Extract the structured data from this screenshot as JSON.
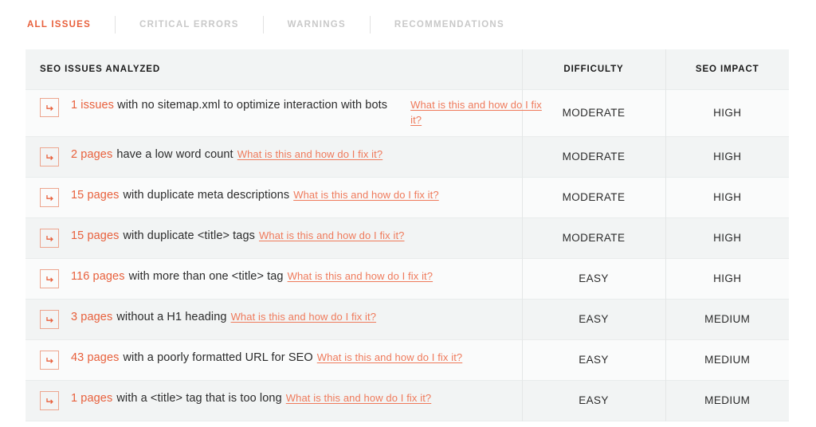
{
  "tabs": [
    {
      "label": "ALL ISSUES",
      "active": true
    },
    {
      "label": "CRITICAL ERRORS",
      "active": false
    },
    {
      "label": "WARNINGS",
      "active": false
    },
    {
      "label": "RECOMMENDATIONS",
      "active": false
    }
  ],
  "table": {
    "columns": {
      "issues": "SEO ISSUES ANALYZED",
      "difficulty": "DIFFICULTY",
      "impact": "SEO IMPACT"
    },
    "link_label": "What is this and how do I fix it?",
    "icon": "arrow-turn-right-icon",
    "rows": [
      {
        "count": "1 issues",
        "description": "with no sitemap.xml to optimize interaction with bots",
        "link": "What is this and how do I fix it?",
        "difficulty": "MODERATE",
        "impact": "HIGH"
      },
      {
        "count": "2 pages",
        "description": "have a low word count",
        "link": "What is this and how do I fix it?",
        "difficulty": "MODERATE",
        "impact": "HIGH"
      },
      {
        "count": "15 pages",
        "description": "with duplicate meta descriptions",
        "link": "What is this and how do I fix it?",
        "difficulty": "MODERATE",
        "impact": "HIGH"
      },
      {
        "count": "15 pages",
        "description": "with duplicate <title> tags",
        "link": "What is this and how do I fix it?",
        "difficulty": "MODERATE",
        "impact": "HIGH"
      },
      {
        "count": "116 pages",
        "description": "with more than one <title> tag",
        "link": "What is this and how do I fix it?",
        "difficulty": "EASY",
        "impact": "HIGH"
      },
      {
        "count": "3 pages",
        "description": "without a H1 heading",
        "link": "What is this and how do I fix it?",
        "difficulty": "EASY",
        "impact": "MEDIUM"
      },
      {
        "count": "43 pages",
        "description": "with a poorly formatted URL for SEO",
        "link": "What is this and how do I fix it?",
        "difficulty": "EASY",
        "impact": "MEDIUM"
      },
      {
        "count": "1 pages",
        "description": "with a <title> tag that is too long",
        "link": "What is this and how do I fix it?",
        "difficulty": "EASY",
        "impact": "MEDIUM"
      }
    ]
  },
  "colors": {
    "accent": "#e8603c",
    "link": "#ef7a5b",
    "icon_border": "#eda58e",
    "tab_inactive": "#c9c9c9",
    "row_odd": "#fafbfb",
    "row_even": "#f2f4f4",
    "header_bg": "#f2f4f4"
  }
}
